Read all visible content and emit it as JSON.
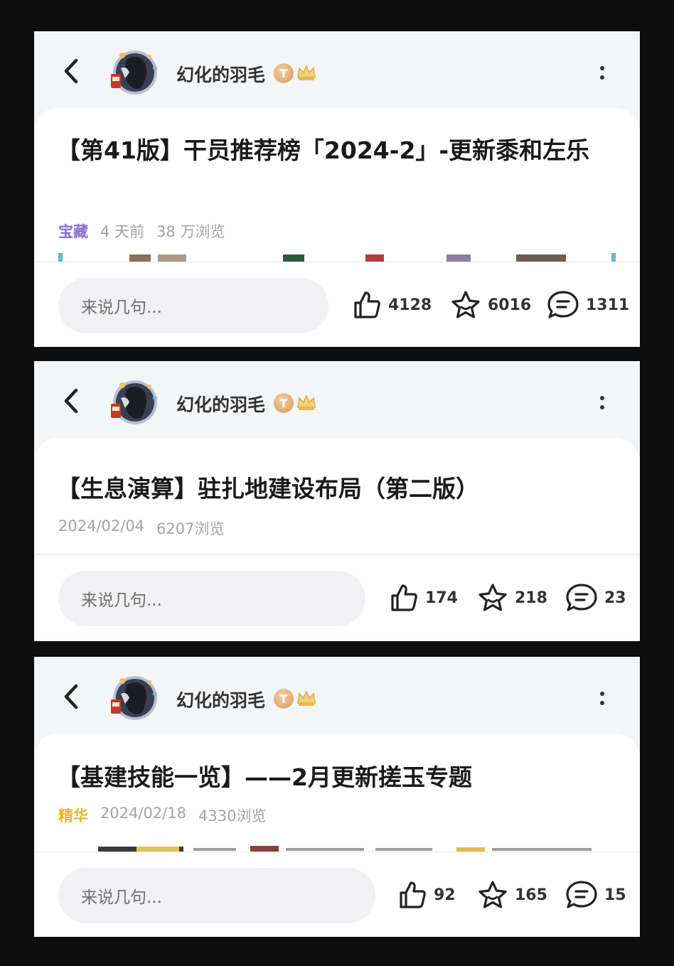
{
  "posts": [
    {
      "author": "幻化的羽毛",
      "badge": "T",
      "title": "【第41版】干员推荐榜「2024-2」-更新黍和左乐",
      "tag": "宝藏",
      "meta": [
        "4 天前",
        "38 万浏览"
      ],
      "comment_placeholder": "来说几句...",
      "likes": "4128",
      "stars": "6016",
      "comments": "1311"
    },
    {
      "author": "幻化的羽毛",
      "badge": "T",
      "title": "【生息演算】驻扎地建设布局（第二版）",
      "meta": [
        "2024/02/04",
        "6207浏览"
      ],
      "comment_placeholder": "来说几句...",
      "likes": "174",
      "stars": "218",
      "comments": "23"
    },
    {
      "author": "幻化的羽毛",
      "badge": "T",
      "title": "【基建技能一览】——2月更新搓玉专题",
      "tag": "精华",
      "meta": [
        "2024/02/18",
        "4330浏览"
      ],
      "comment_placeholder": "来说几句...",
      "likes": "92",
      "stars": "165",
      "comments": "15"
    }
  ],
  "icons": {
    "back": "chevron-left-icon",
    "more": "more-vertical-icon",
    "like": "thumbs-up-icon",
    "star": "star-icon",
    "comment": "comment-icon",
    "crown": "crown-icon"
  },
  "colors": {
    "treasure_tag": "#8c6ad9",
    "featured_tag": "#f3b32c",
    "badge": "#d79a5a"
  }
}
